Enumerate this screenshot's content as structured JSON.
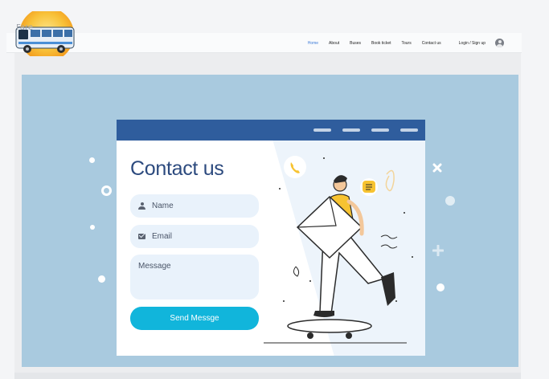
{
  "logo": {
    "text": "Fare"
  },
  "nav": {
    "links": [
      {
        "label": "Home"
      },
      {
        "label": "About"
      },
      {
        "label": "Buses"
      },
      {
        "label": "Book ticket"
      },
      {
        "label": "Tours"
      },
      {
        "label": "Contact us"
      }
    ],
    "login": "Login / Sign up",
    "user_icon": "user-avatar-icon"
  },
  "contact": {
    "title": "Contact us",
    "name_placeholder": "Name",
    "email_placeholder": "Email",
    "message_placeholder": "Message",
    "send_label": "Send Messge"
  },
  "colors": {
    "hero": "#a9cadf",
    "card_header": "#2f5d9d",
    "accent": "#11b5db",
    "title": "#2c4a7e",
    "active_link": "#3d7bd8",
    "illustration_yellow": "#f7c331"
  },
  "icons": [
    "person-icon",
    "mail-icon",
    "phone-icon",
    "chat-icon",
    "envelope-icon",
    "skateboard-icon"
  ]
}
